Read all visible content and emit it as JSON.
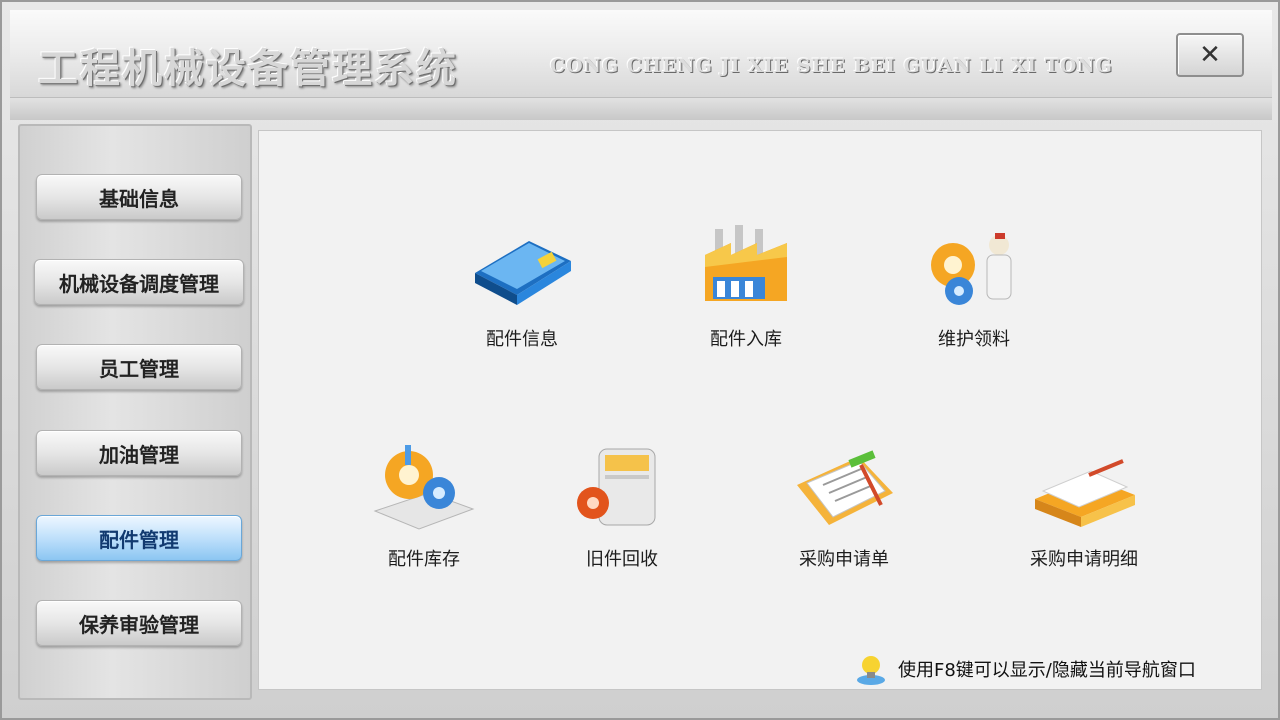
{
  "window": {
    "title": "工程机械设备管理系统",
    "subtitle": "CONG CHENG JI XIE SHE BEI GUAN LI XI TONG",
    "close_label": "✕"
  },
  "sidebar": {
    "items": [
      {
        "label": "基础信息",
        "active": false
      },
      {
        "label": "机械设备调度管理",
        "active": false
      },
      {
        "label": "员工管理",
        "active": false
      },
      {
        "label": "加油管理",
        "active": false
      },
      {
        "label": "配件管理",
        "active": true
      },
      {
        "label": "保养审验管理",
        "active": false
      }
    ]
  },
  "main": {
    "tiles": [
      {
        "label": "配件信息",
        "icon": "blue-binder-icon"
      },
      {
        "label": "配件入库",
        "icon": "factory-icon"
      },
      {
        "label": "维护领料",
        "icon": "gears-worker-icon"
      },
      {
        "label": "配件库存",
        "icon": "gears-box-icon"
      },
      {
        "label": "旧件回收",
        "icon": "recycle-machine-icon"
      },
      {
        "label": "采购申请单",
        "icon": "clipboard-form-icon"
      },
      {
        "label": "采购申请明细",
        "icon": "book-stack-icon"
      }
    ]
  },
  "hint": {
    "text": "使用F8键可以显示/隐藏当前导航窗口",
    "icon": "lightbulb-icon"
  },
  "colors": {
    "active_nav": "#8cc6f2",
    "accent_orange": "#f5a623",
    "accent_blue": "#2a7fd4"
  }
}
